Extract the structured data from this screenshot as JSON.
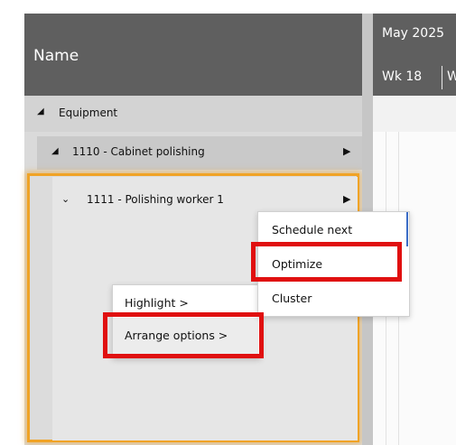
{
  "header": {
    "name_label": "Name",
    "month": "May 2025",
    "week": "Wk 18",
    "week_next": "W"
  },
  "tree": {
    "equipment": {
      "toggle": "◢",
      "label": "Equipment"
    },
    "cabinet": {
      "toggle": "◢",
      "label": "1110 - Cabinet polishing",
      "arrow": "▶"
    },
    "worker": {
      "toggle": "⌄",
      "label": "1111 - Polishing worker 1",
      "arrow": "▶"
    }
  },
  "submenu": {
    "items": [
      "Schedule next",
      "Optimize",
      "Cluster"
    ]
  },
  "context_menu": {
    "items": [
      "Highlight >",
      "Arrange options >"
    ]
  },
  "colors": {
    "header_bg": "#5f5f5f",
    "selection_border": "#f0a326",
    "annotation_red": "#e01010",
    "focus_blue": "#3b6cc7"
  }
}
